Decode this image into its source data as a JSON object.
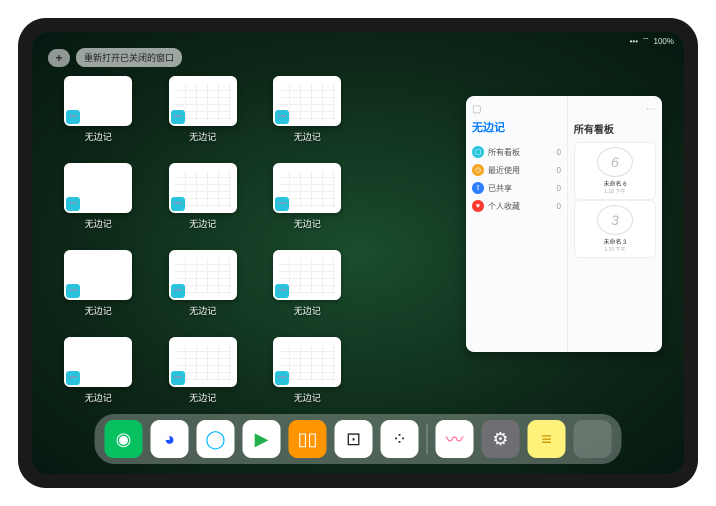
{
  "status": {
    "signal": "•••",
    "wifi": "⌔",
    "battery": "100%"
  },
  "top": {
    "plus": "+",
    "reopen_label": "重新打开已关闭的窗口"
  },
  "stage": {
    "app_label": "无边记",
    "cards": [
      {
        "variant": "blank"
      },
      {
        "variant": "calendar"
      },
      {
        "variant": "calendar"
      },
      {
        "variant": "blank"
      },
      {
        "variant": "calendar"
      },
      {
        "variant": "calendar"
      },
      {
        "variant": "blank"
      },
      {
        "variant": "calendar"
      },
      {
        "variant": "calendar"
      },
      {
        "variant": "blank"
      },
      {
        "variant": "calendar"
      },
      {
        "variant": "calendar"
      }
    ]
  },
  "panel": {
    "title": "无边记",
    "right_title": "所有看板",
    "rows": [
      {
        "icon_color": "#2ac3de",
        "glyph": "▢",
        "label": "所有看板",
        "count": "0"
      },
      {
        "icon_color": "#f5a623",
        "glyph": "◷",
        "label": "最近使用",
        "count": "0"
      },
      {
        "icon_color": "#2b7dff",
        "glyph": "⇧",
        "label": "已共享",
        "count": "0"
      },
      {
        "icon_color": "#ff3b30",
        "glyph": "♥",
        "label": "个人收藏",
        "count": "0"
      }
    ],
    "boards": [
      {
        "sketch": "6",
        "name": "未命名 6",
        "sub": "1.10 下午"
      },
      {
        "sketch": "3",
        "name": "未命名 3",
        "sub": "1.10 下午"
      }
    ]
  },
  "dock": {
    "apps": [
      {
        "name": "wechat-icon",
        "bg": "#07c160",
        "glyph": "◉"
      },
      {
        "name": "quark-icon",
        "bg": "#ffffff",
        "glyph": "◕",
        "fg": "#1e4fff"
      },
      {
        "name": "qqbrowser-icon",
        "bg": "#ffffff",
        "glyph": "◯",
        "fg": "#00b4ff"
      },
      {
        "name": "play-icon",
        "bg": "#ffffff",
        "glyph": "▶",
        "fg": "#22b14c"
      },
      {
        "name": "books-icon",
        "bg": "#ff9500",
        "glyph": "▯▯"
      },
      {
        "name": "dice-icon",
        "bg": "#ffffff",
        "glyph": "⊡",
        "fg": "#222"
      },
      {
        "name": "dots-icon",
        "bg": "#ffffff",
        "glyph": "⁘",
        "fg": "#222"
      }
    ],
    "recent": [
      {
        "name": "freeform-icon",
        "bg": "#ffffff",
        "glyph": "〰",
        "fg": "#ff5a8c"
      },
      {
        "name": "settings-icon",
        "bg": "#6e6e73",
        "glyph": "⚙"
      },
      {
        "name": "notes-icon",
        "bg": "#fff27a",
        "glyph": "≡",
        "fg": "#c99700"
      }
    ]
  }
}
